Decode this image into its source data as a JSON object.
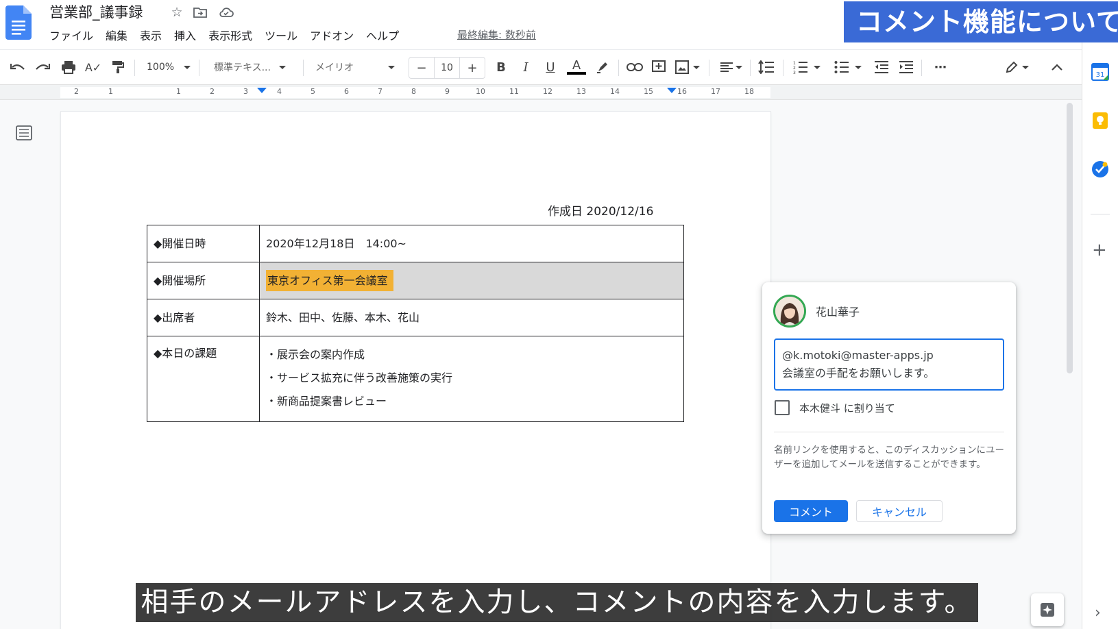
{
  "header": {
    "title": "営業部_議事録",
    "last_edit": "最終編集: 数秒前",
    "menu": [
      "ファイル",
      "編集",
      "表示",
      "挿入",
      "表示形式",
      "ツール",
      "アドオン",
      "ヘルプ"
    ],
    "banner": "コメント機能について"
  },
  "toolbar": {
    "zoom": "100%",
    "style": "標準テキス...",
    "font": "メイリオ",
    "font_size": "10",
    "minus": "−",
    "plus": "+",
    "bold": "B",
    "italic": "I",
    "underline": "U",
    "textcolor": "A",
    "more": "⋯"
  },
  "ruler": {
    "labels": [
      "2",
      "1",
      "1",
      "2",
      "3",
      "4",
      "5",
      "6",
      "7",
      "8",
      "9",
      "10",
      "11",
      "12",
      "13",
      "14",
      "15",
      "16",
      "17",
      "18"
    ]
  },
  "document": {
    "date_line": "作成日 2020/12/16",
    "rows": [
      {
        "label": "◆開催日時",
        "value": "2020年12月18日　14:00~"
      },
      {
        "label": "◆開催場所",
        "value": "東京オフィス第一会議室"
      },
      {
        "label": "◆出席者",
        "value": "鈴木、田中、佐藤、本木、花山"
      },
      {
        "label": "◆本日の課題",
        "tasks": [
          "・展示会の案内作成",
          "・サービス拡充に伴う改善施策の実行",
          "・新商品提案書レビュー"
        ]
      }
    ]
  },
  "comment": {
    "user": "花山華子",
    "input_line1": "@k.motoki@master-apps.jp",
    "input_line2": "会議室の手配をお願いします。",
    "assign_label": "本木健斗 に割り当て",
    "help_text": "名前リンクを使用すると、このディスカッションにユーザーを追加してメールを送信することができます。",
    "submit": "コメント",
    "cancel": "キャンセル"
  },
  "side_panel": {
    "calendar_day": "31",
    "plus": "+",
    "expand": "›"
  },
  "subtitle": "相手のメールアドレスを入力し、コメントの内容を入力します。",
  "colors": {
    "accent": "#1a73e8",
    "highlight": "#f2b134",
    "banner": "#3a6ad6"
  }
}
